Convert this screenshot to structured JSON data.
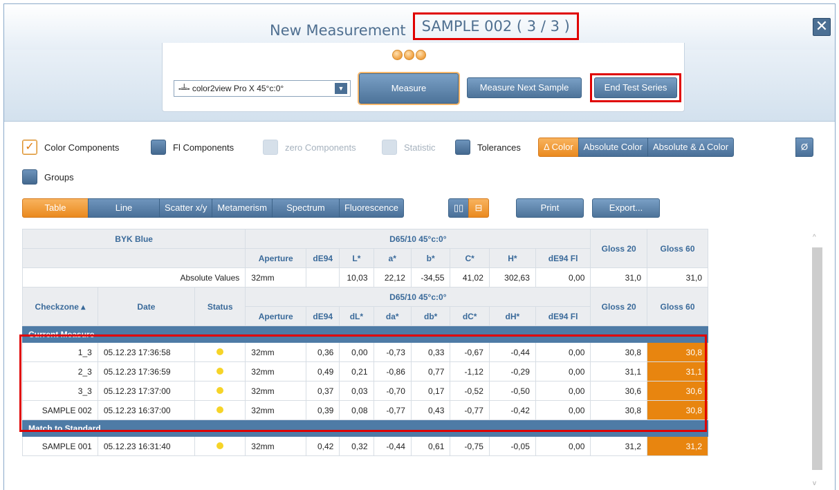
{
  "window": {
    "title": "New Measurement",
    "sample_label": "SAMPLE 002  ( 3 / 3 )",
    "close_glyph": "✕"
  },
  "toolbar": {
    "device": "color2view Pro X 45°c:0°",
    "device_arrow": "▼",
    "measure_label": "Measure",
    "next_label": "Measure Next Sample",
    "end_label": "End Test Series"
  },
  "options": {
    "color_components": "Color Components",
    "color_check": "✓",
    "fl_components": "Fl Components",
    "zero_components": "zero Components",
    "statistic": "Statistic",
    "tolerances": "Tolerances",
    "groups": "Groups",
    "modes": [
      "Δ Color",
      "Absolute Color",
      "Absolute & Δ Color"
    ],
    "diameter": "Ø"
  },
  "views": {
    "tabs": [
      "Table",
      "Line",
      "Scatter x/y",
      "Metamerism",
      "Spectrum",
      "Fluorescence"
    ],
    "print": "Print",
    "export": "Export..."
  },
  "table": {
    "standard_name": "BYK Blue",
    "illuminant": "D65/10 45°c:0°",
    "abs_headers": [
      "Aperture",
      "dE94",
      "L*",
      "a*",
      "b*",
      "C*",
      "H*",
      "dE94 Fl"
    ],
    "gloss_headers": [
      "Gloss 20",
      "Gloss 60"
    ],
    "abs_label": "Absolute Values",
    "abs_values": [
      "32mm",
      "",
      "10,03",
      "22,12",
      "-34,55",
      "41,02",
      "302,63",
      "0,00",
      "31,0",
      "31,0"
    ],
    "left_headers": [
      "Checkzone ▴",
      "Date",
      "Status"
    ],
    "delta_headers": [
      "Aperture",
      "dE94",
      "dL*",
      "da*",
      "db*",
      "dC*",
      "dH*",
      "dE94 Fl"
    ],
    "current_label": "Current Measure",
    "match_label": "Match to Standard",
    "current_rows": [
      [
        "1_3",
        "05.12.23 17:36:58",
        "32mm",
        "0,36",
        "0,00",
        "-0,73",
        "0,33",
        "-0,67",
        "-0,44",
        "0,00",
        "30,8",
        "30,8"
      ],
      [
        "2_3",
        "05.12.23 17:36:59",
        "32mm",
        "0,49",
        "0,21",
        "-0,86",
        "0,77",
        "-1,12",
        "-0,29",
        "0,00",
        "31,1",
        "31,1"
      ],
      [
        "3_3",
        "05.12.23 17:37:00",
        "32mm",
        "0,37",
        "0,03",
        "-0,70",
        "0,17",
        "-0,52",
        "-0,50",
        "0,00",
        "30,6",
        "30,6"
      ],
      [
        "SAMPLE 002",
        "05.12.23 16:37:00",
        "32mm",
        "0,39",
        "0,08",
        "-0,77",
        "0,43",
        "-0,77",
        "-0,42",
        "0,00",
        "30,8",
        "30,8"
      ]
    ],
    "match_rows": [
      [
        "SAMPLE 001",
        "05.12.23 16:31:40",
        "32mm",
        "0,42",
        "0,32",
        "-0,44",
        "0,61",
        "-0,75",
        "-0,05",
        "0,00",
        "31,2",
        "31,2"
      ]
    ]
  },
  "scroll": {
    "up": "^",
    "down": "v"
  }
}
